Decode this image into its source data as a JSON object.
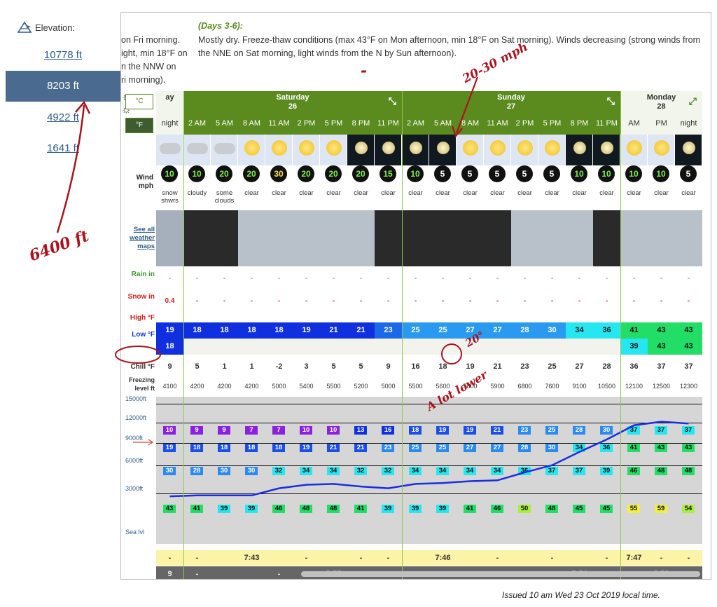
{
  "elevation": {
    "header": "Elevation:",
    "options": [
      "10778 ft",
      "8203 ft",
      "4922 ft",
      "1641 ft"
    ],
    "active_index": 1
  },
  "summary": {
    "prev_fragment": [
      "on Fri morning.",
      "ight, min 18°F on",
      "n the NNW on",
      "ri morning)."
    ],
    "heading": "(Days 3-6):",
    "text": "Mostly dry. Freeze-thaw conditions (max 43°F on Mon afternoon, min 18°F on Sat morning). Winds decreasing (strong winds from the NNE on Sat morning, light winds from the N by Sun afternoon)."
  },
  "units": {
    "celsius": "°C",
    "fahrenheit": "°F"
  },
  "days": [
    {
      "name": "Saturday",
      "date": "26"
    },
    {
      "name": "Sunday",
      "date": "27"
    },
    {
      "name": "Monday",
      "date": "28"
    }
  ],
  "prev_day_fragment": [
    "ay",
    "5"
  ],
  "times": [
    "night",
    "2 AM",
    "5 AM",
    "8 AM",
    "11 AM",
    "2 PM",
    "5 PM",
    "8 PM",
    "11 PM",
    "2 AM",
    "5 AM",
    "8 AM",
    "11 AM",
    "2 PM",
    "5 PM",
    "8 PM",
    "11 PM",
    "AM",
    "PM",
    "night"
  ],
  "row_labels": {
    "wind": "Wind mph",
    "see_maps": "See all weather maps",
    "rain": "Rain in",
    "snow": "Snow in",
    "high": "High °F",
    "low": "Low °F",
    "chill": "Chill °F",
    "freezing": "Freezing level ft"
  },
  "wind": [
    "10",
    "10",
    "20",
    "20",
    "30",
    "20",
    "20",
    "20",
    "15",
    "10",
    "5",
    "5",
    "5",
    "5",
    "5",
    "10",
    "10",
    "10",
    "10",
    "5"
  ],
  "weather_labels": [
    "snow shwrs",
    "cloudy",
    "some clouds",
    "clear",
    "clear",
    "clear",
    "clear",
    "clear",
    "clear",
    "clear",
    "clear",
    "clear",
    "clear",
    "clear",
    "clear",
    "clear",
    "clear",
    "clear",
    "clear",
    "clear"
  ],
  "prev_weather_fragment": "w rs",
  "rain": [
    "-",
    "-",
    "-",
    "-",
    "-",
    "-",
    "-",
    "-",
    "-",
    "-",
    "-",
    "-",
    "-",
    "-",
    "-",
    "-",
    "-",
    "-",
    "-",
    "-"
  ],
  "snow": [
    "0.4",
    "-",
    "-",
    "-",
    "-",
    "-",
    "-",
    "-",
    "-",
    "-",
    "-",
    "-",
    "-",
    "-",
    "-",
    "-",
    "-",
    "-",
    "-",
    "-"
  ],
  "high": [
    "19",
    "18",
    "18",
    "18",
    "18",
    "19",
    "21",
    "21",
    "23",
    "25",
    "25",
    "27",
    "27",
    "28",
    "30",
    "34",
    "36",
    "41",
    "43",
    "43"
  ],
  "low": [
    "18",
    "",
    "",
    "",
    "",
    "",
    "",
    "",
    "",
    "",
    "",
    "",
    "",
    "",
    "",
    "",
    "",
    "39",
    "43",
    "43"
  ],
  "chill": [
    "9",
    "5",
    "1",
    "1",
    "-2",
    "3",
    "5",
    "5",
    "9",
    "16",
    "18",
    "19",
    "21",
    "23",
    "25",
    "27",
    "28",
    "36",
    "37",
    "37"
  ],
  "freezing": [
    "4100",
    "4200",
    "4200",
    "4200",
    "5000",
    "5400",
    "5500",
    "5200",
    "5000",
    "5500",
    "5600",
    "5800",
    "5900",
    "6800",
    "7600",
    "9100",
    "10500",
    "12100",
    "12500",
    "12300"
  ],
  "height_labels": [
    "15000ft",
    "12000ft",
    "9000ft",
    "6000ft",
    "3000ft",
    "Sea lvl"
  ],
  "band_12000": [
    "10",
    "9",
    "9",
    "7",
    "7",
    "10",
    "10",
    "13",
    "16",
    "18",
    "19",
    "19",
    "21",
    "23",
    "25",
    "28",
    "30",
    "37",
    "37",
    "37"
  ],
  "band_9000": [
    "19",
    "18",
    "18",
    "18",
    "18",
    "19",
    "21",
    "21",
    "23",
    "25",
    "25",
    "27",
    "27",
    "28",
    "30",
    "34",
    "36",
    "41",
    "43",
    "43"
  ],
  "band_6000": [
    "30",
    "28",
    "30",
    "30",
    "32",
    "34",
    "34",
    "32",
    "32",
    "34",
    "34",
    "34",
    "34",
    "36",
    "37",
    "37",
    "39",
    "46",
    "48",
    "48"
  ],
  "band_3000": [
    "43",
    "41",
    "39",
    "39",
    "46",
    "48",
    "48",
    "41",
    "39",
    "39",
    "39",
    "41",
    "46",
    "50",
    "48",
    "45",
    "45",
    "55",
    "59",
    "54"
  ],
  "sunrise": [
    "-",
    "-",
    "7:43",
    "-",
    "-",
    "-",
    "7:46",
    "-",
    "-",
    "-",
    "7:47",
    "-",
    "-"
  ],
  "sunset": [
    "9",
    "-",
    "-",
    "5:57",
    "-",
    "-",
    "-",
    "5:54",
    "-",
    "-",
    "5:52",
    "-"
  ],
  "issued": "Issued 10 am Wed 23 Oct 2019 local time.",
  "annotations": {
    "mph": "20-30 mph",
    "deg": "20°",
    "lower": "A lot lower",
    "elev": "6400 ft"
  },
  "colors": {
    "accent_green": "#5b8a1f",
    "link_blue": "#2f5d8a",
    "ink_red": "#a8141e"
  }
}
